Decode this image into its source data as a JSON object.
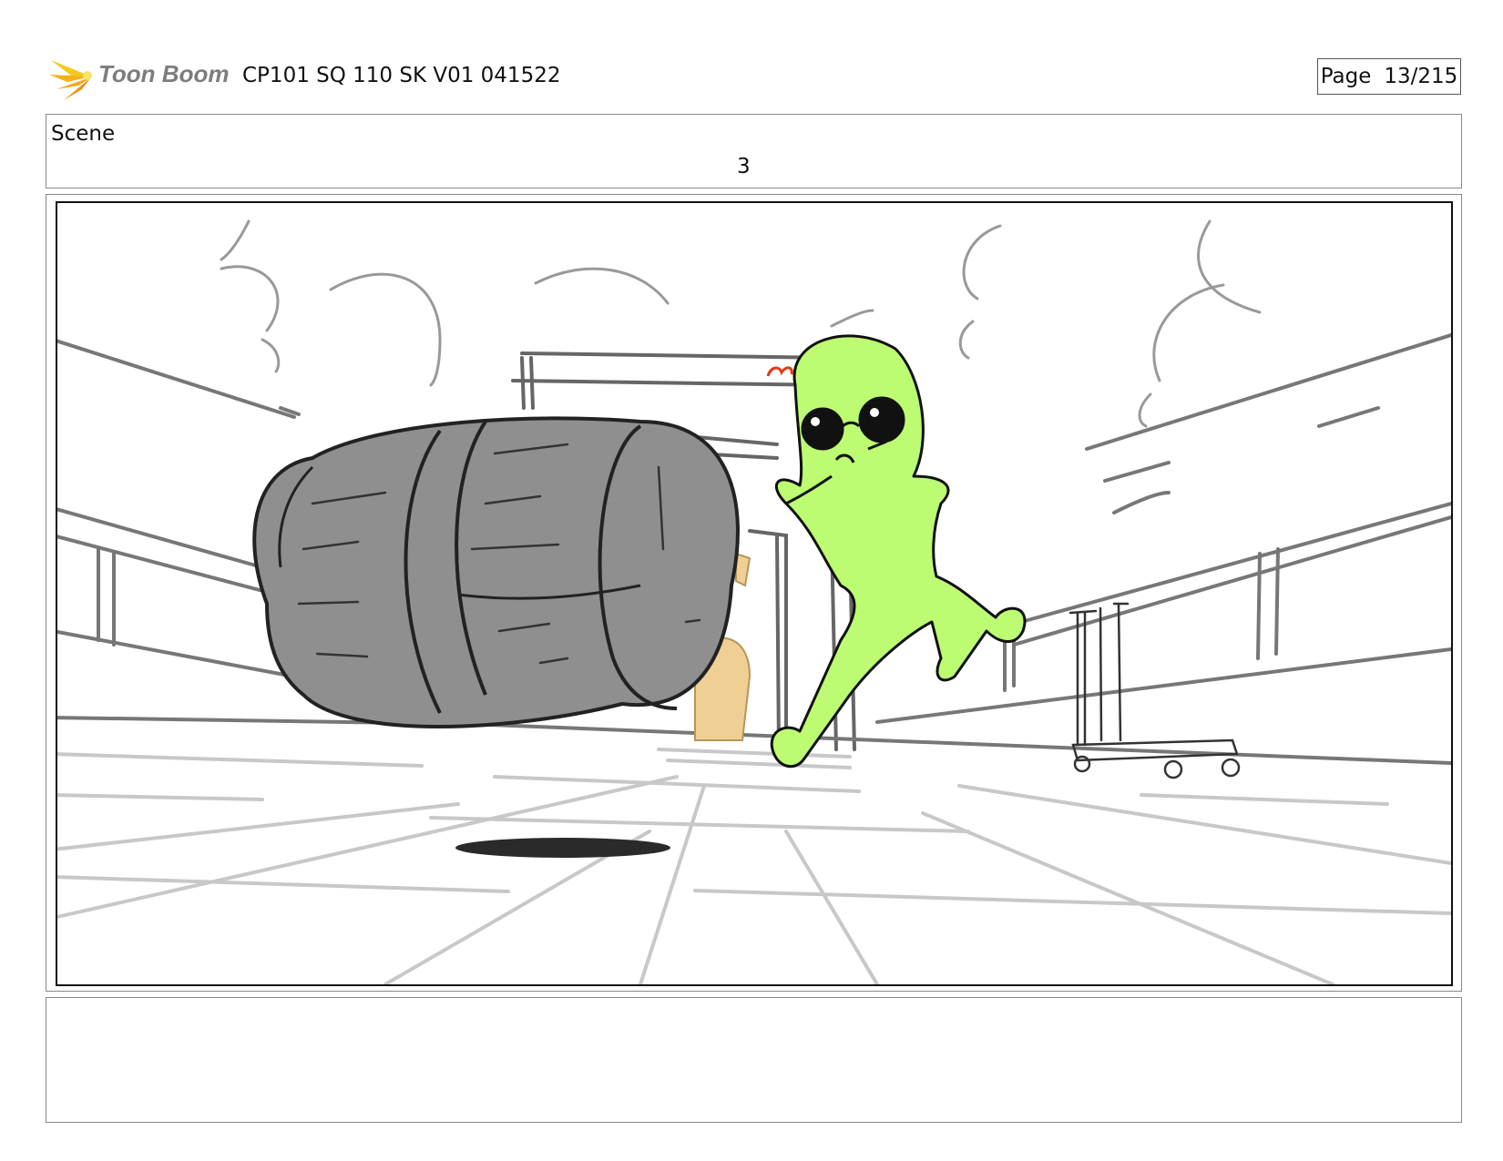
{
  "header": {
    "logo_text": "Toon Boom",
    "document_title": "CP101 SQ 110 SK V01 041522",
    "page_label": "Page",
    "page_value": "13/215"
  },
  "scene": {
    "label": "Scene",
    "number": "3"
  },
  "panel": {
    "description_icons": [
      "barrel-icon",
      "green-character-icon",
      "cart-icon"
    ],
    "colors": {
      "character_green": "#bdfb72",
      "barrel_gray": "#8f8f8f",
      "background_figure": "#f0cf94",
      "hair_accent": "#e63a12"
    }
  },
  "notes": {
    "text": ""
  }
}
